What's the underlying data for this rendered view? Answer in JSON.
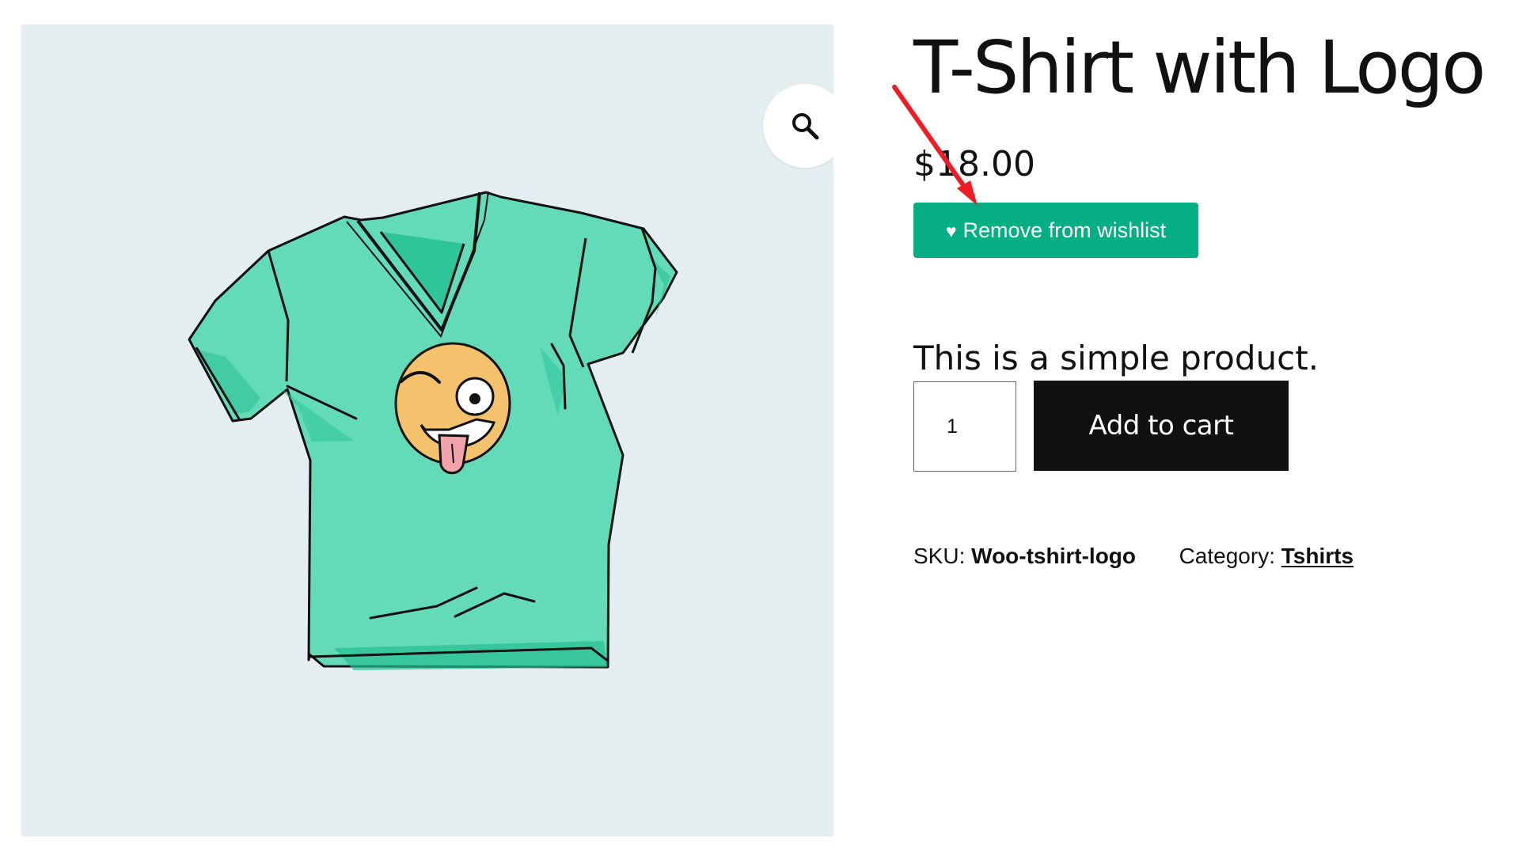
{
  "product": {
    "title": "T-Shirt with Logo",
    "price": "$18.00",
    "description": "This is a simple product.",
    "sku_label": "SKU:",
    "sku_value": "Woo-tshirt-logo",
    "category_label": "Category:",
    "category_value": "Tshirts"
  },
  "actions": {
    "wishlist_icon": "♥",
    "wishlist_label": "Remove from wishlist",
    "quantity": "1",
    "add_to_cart_label": "Add to cart"
  },
  "gallery": {
    "zoom_icon": "magnifier-icon",
    "image_subject": "t-shirt-with-winking-emoji"
  },
  "colors": {
    "accent": "#06ae84",
    "button_dark": "#111111",
    "image_background": "#e4eef1",
    "annotation": "#ee1c24",
    "shirt": "#64dbb7"
  }
}
